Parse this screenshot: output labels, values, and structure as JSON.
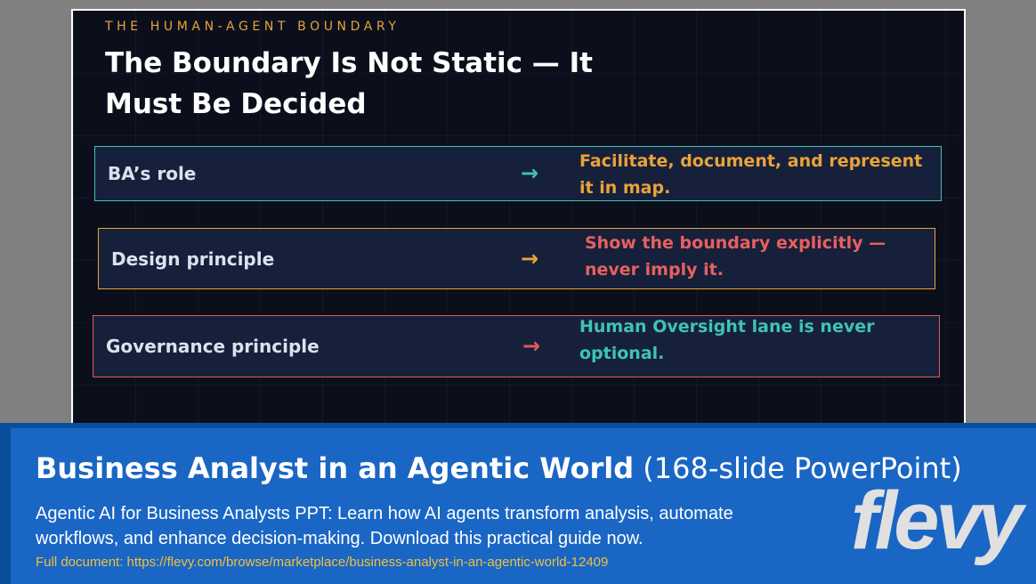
{
  "slide": {
    "eyebrow": "THE HUMAN-AGENT BOUNDARY",
    "title": "The Boundary Is Not Static — It Must Be Decided",
    "rows": [
      {
        "label": "BA’s role",
        "arrow": "→",
        "value": "Facilitate, document, and represent it in map.",
        "border_color": "#3ec3b8",
        "value_color": "#e8a33a"
      },
      {
        "label": "Design principle",
        "arrow": "→",
        "value": "Show the boundary explicitly — never imply it.",
        "border_color": "#e8a33a",
        "value_color": "#e86060"
      },
      {
        "label": "Governance principle",
        "arrow": "→",
        "value": "Human Oversight lane is never optional.",
        "border_color": "#e05a5a",
        "value_color": "#3ec3b8"
      }
    ]
  },
  "banner": {
    "title_bold": "Business Analyst in an Agentic World",
    "title_light": "(168-slide PowerPoint)",
    "description": "Agentic AI for Business Analysts PPT: Learn how AI agents transform analysis, automate workflows, and enhance decision-making. Download this practical guide now.",
    "link": "Full document: https://flevy.com/browse/marketplace/business-analyst-in-an-agentic-world-12409",
    "logo": "flevy"
  }
}
